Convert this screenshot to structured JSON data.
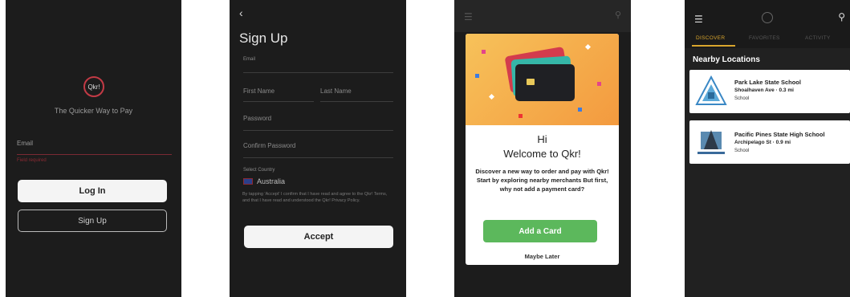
{
  "screen1": {
    "logo_text": "Qkr!",
    "tagline": "The Quicker Way to Pay",
    "email_label": "Email",
    "email_error": "Field required",
    "login_label": "Log In",
    "signup_label": "Sign Up"
  },
  "screen2": {
    "back_icon": "back-arrow-icon",
    "title": "Sign Up",
    "fields": {
      "email": "Email",
      "first_name": "First Name",
      "last_name": "Last Name",
      "password": "Password",
      "confirm_password": "Confirm Password",
      "select_country": "Select Country"
    },
    "country_value": "Australia",
    "legal": "By tapping 'Accept' I confirm that I have read and agree to the Qkr! Terms, and that I have read and understood the Qkr! Privacy Policy.",
    "accept_label": "Accept"
  },
  "screen3": {
    "hi": "Hi",
    "welcome": "Welcome to Qkr!",
    "body": "Discover a new way to order and pay with Qkr! Start by exploring nearby merchants But first, why not add a payment card?",
    "add_card_label": "Add a Card",
    "maybe_later_label": "Maybe Later",
    "colors": {
      "green": "#5cb85c",
      "hero": "#f7c25a"
    }
  },
  "screen4": {
    "tabs": [
      "DISCOVER",
      "FAVORITES",
      "ACTIVITY"
    ],
    "section_title": "Nearby Locations",
    "locations": [
      {
        "name": "Park Lake State School",
        "address": "Shoalhaven Ave · 0.3 mi",
        "type": "School"
      },
      {
        "name": "Pacific Pines State High School",
        "address": "Archipelago St · 0.9 mi",
        "type": "School"
      }
    ],
    "accent": "#d9a52d"
  }
}
